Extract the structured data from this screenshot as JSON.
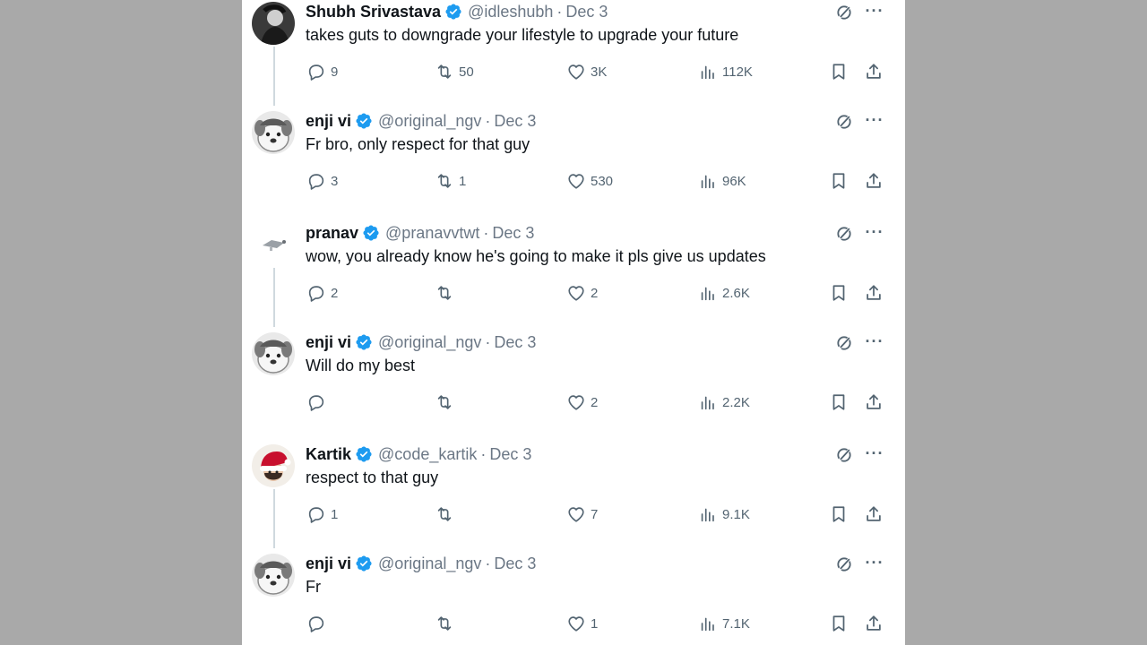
{
  "tweets": [
    {
      "name": "Shubh Srivastava",
      "handle": "@idleshubh",
      "date": "Dec 3",
      "text": "takes guts to downgrade your lifestyle to upgrade your future",
      "replies": "9",
      "retweets": "50",
      "likes": "3K",
      "views": "112K",
      "avatar": "dark"
    },
    {
      "name": "enji vi",
      "handle": "@original_ngv",
      "date": "Dec 3",
      "text": "Fr bro, only respect for that guy",
      "replies": "3",
      "retweets": "1",
      "likes": "530",
      "views": "96K",
      "avatar": "dog"
    },
    {
      "name": "pranav",
      "handle": "@pranavvtwt",
      "date": "Dec 3",
      "text": "wow, you already know he's going to make it pls give us updates",
      "replies": "2",
      "retweets": "",
      "likes": "2",
      "views": "2.6K",
      "avatar": "light"
    },
    {
      "name": "enji vi",
      "handle": "@original_ngv",
      "date": "Dec 3",
      "text": "Will do my best",
      "replies": "",
      "retweets": "",
      "likes": "2",
      "views": "2.2K",
      "avatar": "dog"
    },
    {
      "name": "Kartik",
      "handle": "@code_kartik",
      "date": "Dec 3",
      "text": "respect to that guy",
      "replies": "1",
      "retweets": "",
      "likes": "7",
      "views": "9.1K",
      "avatar": "santa"
    },
    {
      "name": "enji vi",
      "handle": "@original_ngv",
      "date": "Dec 3",
      "text": "Fr",
      "replies": "",
      "retweets": "",
      "likes": "1",
      "views": "7.1K",
      "avatar": "dog"
    }
  ],
  "separator": "·",
  "colors": {
    "verified": "#1d9bf0",
    "muted": "#536471",
    "background": "#a9a9a9"
  },
  "icons": [
    "verified-badge-icon",
    "grok-icon",
    "more-icon",
    "reply-icon",
    "retweet-icon",
    "like-icon",
    "views-icon",
    "bookmark-icon",
    "share-icon"
  ]
}
